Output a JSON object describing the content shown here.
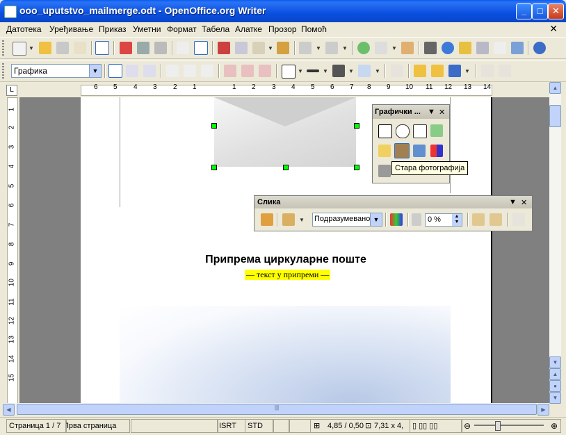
{
  "window": {
    "title": "ooo_uputstvo_mailmerge.odt - OpenOffice.org Writer",
    "minimize_glyph": "_",
    "maximize_glyph": "□",
    "close_glyph": "✕"
  },
  "menu": {
    "items": [
      "Датотека",
      "Уређивање",
      "Приказ",
      "Уметни",
      "Формат",
      "Табела",
      "Алатке",
      "Прозор",
      "Помоћ"
    ],
    "close_glyph": "✕"
  },
  "formatting": {
    "style_value": "Графика"
  },
  "ruler": {
    "horizontal_ticks": [
      "6",
      "5",
      "4",
      "3",
      "2",
      "1",
      "1",
      "2",
      "3",
      "4",
      "5",
      "6",
      "7",
      "8",
      "9",
      "10",
      "11",
      "12",
      "13",
      "14"
    ],
    "vertical_ticks": [
      "1",
      "2",
      "3",
      "4",
      "5",
      "6",
      "7",
      "8",
      "9",
      "10",
      "11",
      "12",
      "13",
      "14",
      "15"
    ]
  },
  "document": {
    "heading": "Припрема циркуларне поште",
    "subtitle": "— текст у припреми —"
  },
  "graphics_toolbar": {
    "title": "Графички ...",
    "tooltip": "Стара фотографија"
  },
  "picture_toolbar": {
    "title": "Слика",
    "graphics_mode": "Подразумевано",
    "transparency": "0 %"
  },
  "statusbar": {
    "page": "Страница 1 / 7",
    "page_style": "Прва страница",
    "insert_mode": "ISRT",
    "selection_mode": "STD",
    "position": "4,85 / 0,50",
    "size": "7,31 x 4,"
  },
  "colors": {
    "title_bar": "#0a4fe0",
    "highlight": "#ffff00",
    "selection_handle": "#00ff00",
    "tooltip_bg": "#ffffe1"
  }
}
